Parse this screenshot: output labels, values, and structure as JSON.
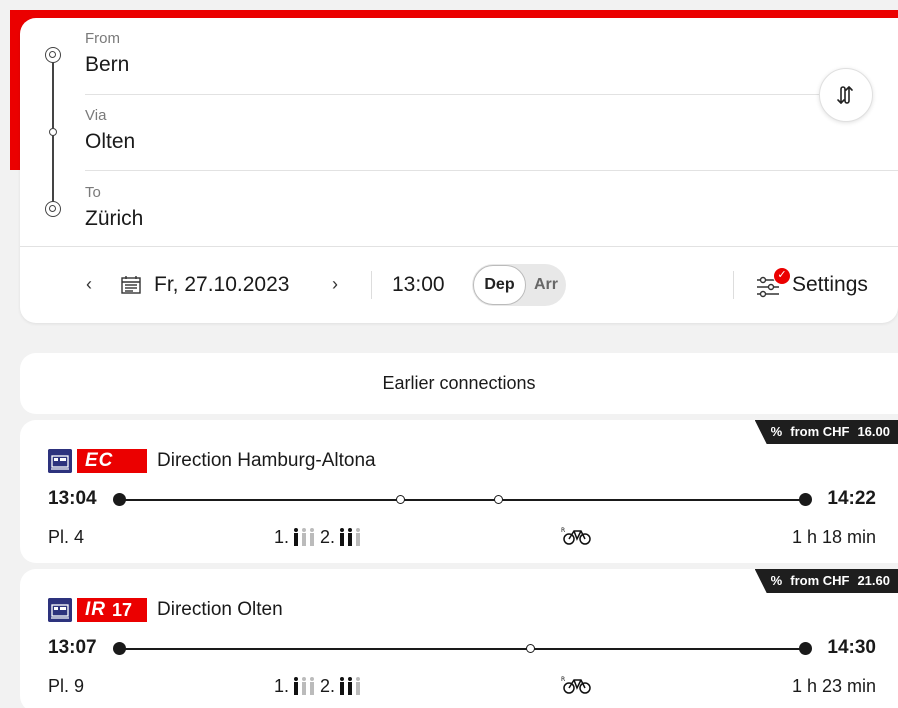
{
  "form": {
    "from": {
      "label": "From",
      "value": "Bern"
    },
    "via": {
      "label": "Via",
      "value": "Olten"
    },
    "to": {
      "label": "To",
      "value": "Zürich"
    },
    "date": "Fr, 27.10.2023",
    "time": "13:00",
    "dep_label": "Dep",
    "arr_label": "Arr",
    "dep_selected": true,
    "settings_label": "Settings"
  },
  "earlier_label": "Earlier connections",
  "colors": {
    "brand_red": "#eb0000",
    "operator_blue": "#2d327d",
    "dark": "#1e1e1e"
  },
  "connections": [
    {
      "price_prefix": "%",
      "price_text": "from CHF",
      "price_value": "16.00",
      "train_type": "EC",
      "train_number": "",
      "direction": "Direction Hamburg-Altona",
      "dep_time": "13:04",
      "arr_time": "14:22",
      "platform": "Pl. 4",
      "class1": "1.",
      "class2": "2.",
      "class1_occupancy": 1,
      "class2_occupancy": 2,
      "duration": "1 h 18 min",
      "bike_icon": "bike-reservation-icon"
    },
    {
      "price_prefix": "%",
      "price_text": "from CHF",
      "price_value": "21.60",
      "train_type": "IR",
      "train_number": "17",
      "direction": "Direction Olten",
      "dep_time": "13:07",
      "arr_time": "14:30",
      "platform": "Pl. 9",
      "class1": "1.",
      "class2": "2.",
      "class1_occupancy": 1,
      "class2_occupancy": 2,
      "duration": "1 h 23 min",
      "bike_icon": "bike-reservation-icon"
    }
  ]
}
